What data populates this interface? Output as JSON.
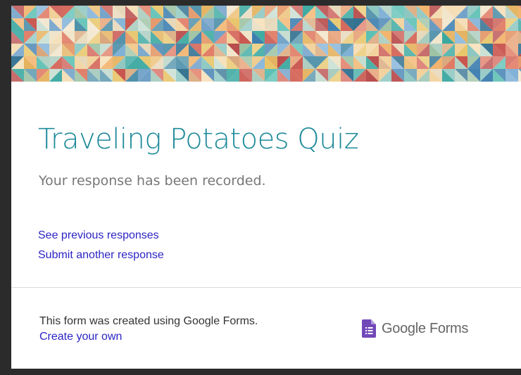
{
  "form": {
    "title": "Traveling Potatoes Quiz",
    "confirmation": "Your response has been recorded.",
    "links": {
      "previous": "See previous responses",
      "another": "Submit another response"
    }
  },
  "footer": {
    "note": "This form was created using Google Forms.",
    "create_link": "Create your own",
    "brand": "Google Forms"
  },
  "colors": {
    "title": "#1d8a99",
    "link": "#2c24c4",
    "brand_icon": "#7248b9"
  },
  "icons": {
    "brand": "google-forms-icon"
  }
}
